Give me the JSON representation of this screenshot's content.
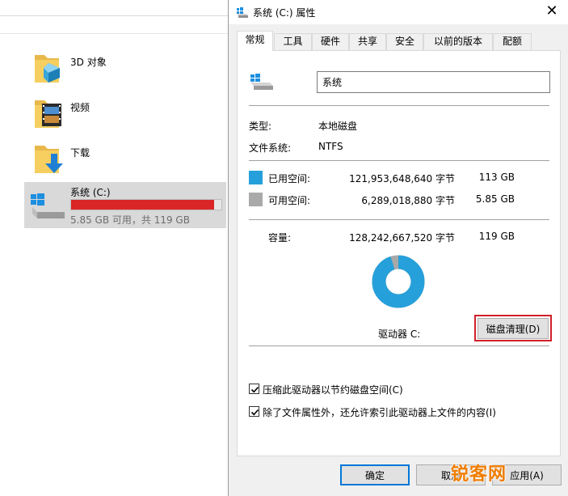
{
  "explorer": {
    "items": [
      {
        "label": "3D 对象",
        "icon": "3d-objects-folder-icon"
      },
      {
        "label": "视频",
        "icon": "videos-folder-icon"
      },
      {
        "label": "下载",
        "icon": "downloads-folder-icon"
      }
    ],
    "drive": {
      "name": "系统 (C:)",
      "usage": "5.85 GB 可用，共 119 GB",
      "used_fraction": 0.951,
      "bar_color": "#da2626"
    }
  },
  "dialog": {
    "title": "系统 (C:) 属性",
    "close_glyph": "✕",
    "tabs": [
      "常规",
      "工具",
      "硬件",
      "共享",
      "安全",
      "以前的版本",
      "配额"
    ],
    "active_tab": 0,
    "name_value": "系统",
    "type_label": "类型:",
    "type_value": "本地磁盘",
    "fs_label": "文件系统:",
    "fs_value": "NTFS",
    "used": {
      "label": "已用空间:",
      "bytes": "121,953,648,640 字节",
      "size": "113 GB",
      "color": "#26a0da"
    },
    "free": {
      "label": "可用空间:",
      "bytes": "6,289,018,880 字节",
      "size": "5.85 GB",
      "color": "#a9a9a9"
    },
    "capacity": {
      "label": "容量:",
      "bytes": "128,242,667,520 字节",
      "size": "119 GB"
    },
    "drive_label": "驱动器 C:",
    "clean_button": "磁盘清理(D)",
    "compress_label": "压缩此驱动器以节约磁盘空间(C)",
    "compress_checked": true,
    "index_label": "除了文件属性外，还允许索引此驱动器上文件的内容(I)",
    "index_checked": true,
    "ok_button": "确定",
    "cancel_button": "取消",
    "apply_button": "应用(A)"
  },
  "watermark": "锐客网"
}
